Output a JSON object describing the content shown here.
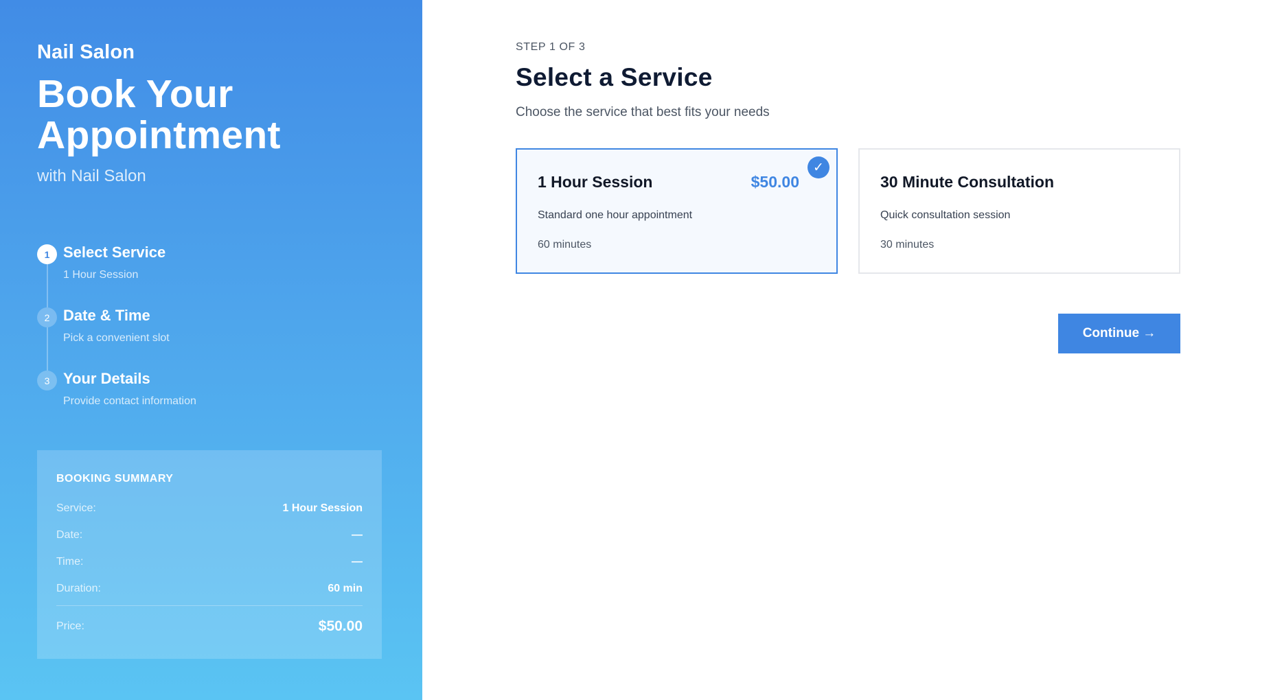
{
  "sidebar": {
    "brand": "Nail Salon",
    "headline": "Book Your Appointment",
    "subline": "with Nail Salon",
    "steps": [
      {
        "number": "1",
        "title": "Select Service",
        "subtitle": "1 Hour Session",
        "active": true
      },
      {
        "number": "2",
        "title": "Date & Time",
        "subtitle": "Pick a convenient slot",
        "active": false
      },
      {
        "number": "3",
        "title": "Your Details",
        "subtitle": "Provide contact information",
        "active": false
      }
    ],
    "summary": {
      "heading": "BOOKING SUMMARY",
      "rows": [
        {
          "label": "Service:",
          "value": "1 Hour Session"
        },
        {
          "label": "Date:",
          "value": "—"
        },
        {
          "label": "Time:",
          "value": "—"
        },
        {
          "label": "Duration:",
          "value": "60 min"
        }
      ],
      "price_label": "Price:",
      "price_value": "$50.00"
    }
  },
  "main": {
    "step_label": "STEP 1 OF 3",
    "title": "Select a Service",
    "subtitle": "Choose the service that best fits your needs",
    "services": [
      {
        "name": "1 Hour Session",
        "price": "$50.00",
        "description": "Standard one hour appointment",
        "duration": "60 minutes",
        "selected": true
      },
      {
        "name": "30 Minute Consultation",
        "price": "",
        "description": "Quick consultation session",
        "duration": "30 minutes",
        "selected": false
      }
    ],
    "continue_label": "Continue →",
    "check_glyph": "✓"
  },
  "colors": {
    "accent": "#3f86e2",
    "sidebar_top": "#418ce6",
    "sidebar_bottom": "#5ac4f3"
  }
}
